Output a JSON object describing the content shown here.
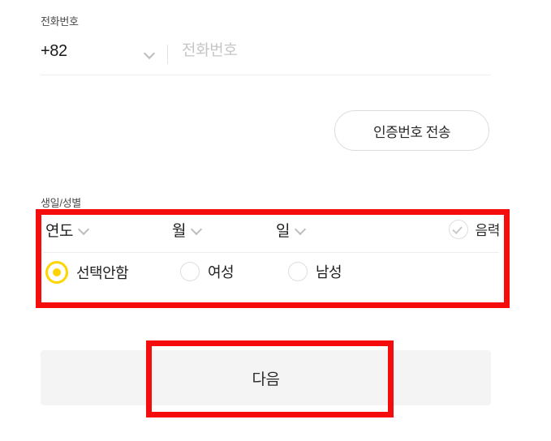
{
  "theme": {
    "accent_yellow": "#FFD400",
    "annotation_red": "#F50D0D",
    "text_primary": "#1f1f1f",
    "placeholder_gray": "#c6c6c6",
    "button_gray": "#f4f4f4"
  },
  "phone_section": {
    "label": "전화번호",
    "country_code": "+82",
    "country_chevron_icon": "chevron-down-icon",
    "input_value": "",
    "input_placeholder": "전화번호",
    "send_code_label": "인증번호 전송"
  },
  "birth_gender_section": {
    "label": "생일/성별",
    "date_selects": [
      {
        "name": "year",
        "value": "연도",
        "chevron_icon": "chevron-down-icon"
      },
      {
        "name": "month",
        "value": "월",
        "chevron_icon": "chevron-down-icon"
      },
      {
        "name": "day",
        "value": "일",
        "chevron_icon": "chevron-down-icon"
      }
    ],
    "lunar_checkbox": {
      "label": "음력",
      "icon": "check-circle-icon",
      "checked": false
    },
    "gender_options": [
      {
        "name": "none",
        "label": "선택안함",
        "selected": true
      },
      {
        "name": "female",
        "label": "여성",
        "selected": false
      },
      {
        "name": "male",
        "label": "남성",
        "selected": false
      }
    ]
  },
  "submit": {
    "next_label": "다음"
  },
  "annotations": [
    {
      "name": "birth-gender-highlight",
      "color": "#F50D0D"
    },
    {
      "name": "next-button-highlight",
      "color": "#F50D0D"
    }
  ]
}
